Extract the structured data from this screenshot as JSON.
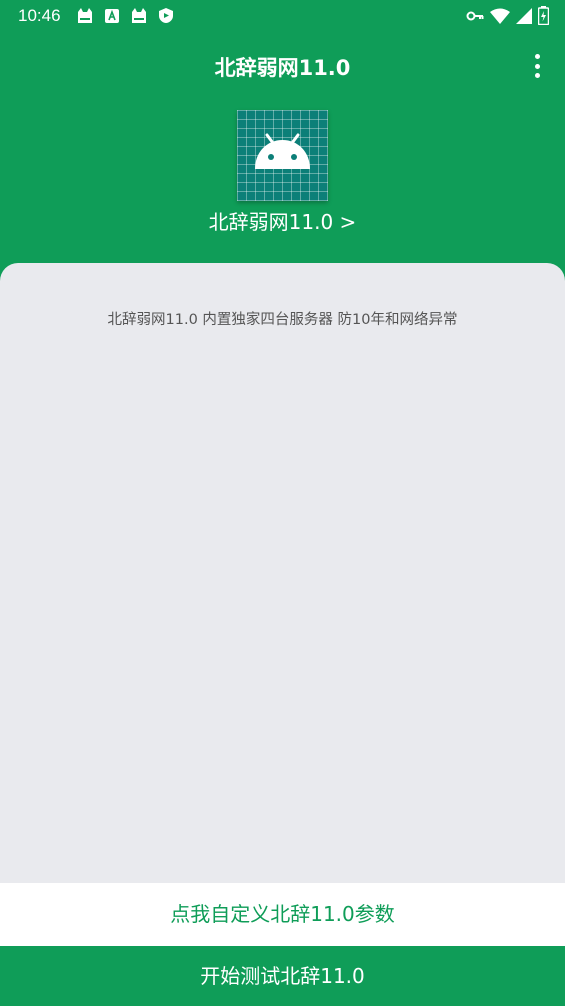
{
  "status_bar": {
    "time": "10:46",
    "left_icons": [
      "cat-icon",
      "a-icon",
      "cat-icon",
      "shield-icon"
    ],
    "right_icons": [
      "vpn-key-icon",
      "wifi-icon",
      "signal-icon",
      "battery-icon"
    ]
  },
  "app_bar": {
    "title": "北辞弱网11.0",
    "menu_icon": "more-vert-icon"
  },
  "header": {
    "logo_icon": "android-icon",
    "app_name_link": "北辞弱网11.0 >"
  },
  "content": {
    "description": "北辞弱网11.0 内置独家四台服务器 防10年和网络异常"
  },
  "buttons": {
    "customize_label": "点我自定义北辞11.0参数",
    "start_label": "开始测试北辞11.0"
  },
  "colors": {
    "primary": "#0f9d58",
    "card_background": "#e9eaee",
    "logo_background": "#0c7f78",
    "text_on_primary": "#ffffff",
    "description_text": "#555555"
  }
}
